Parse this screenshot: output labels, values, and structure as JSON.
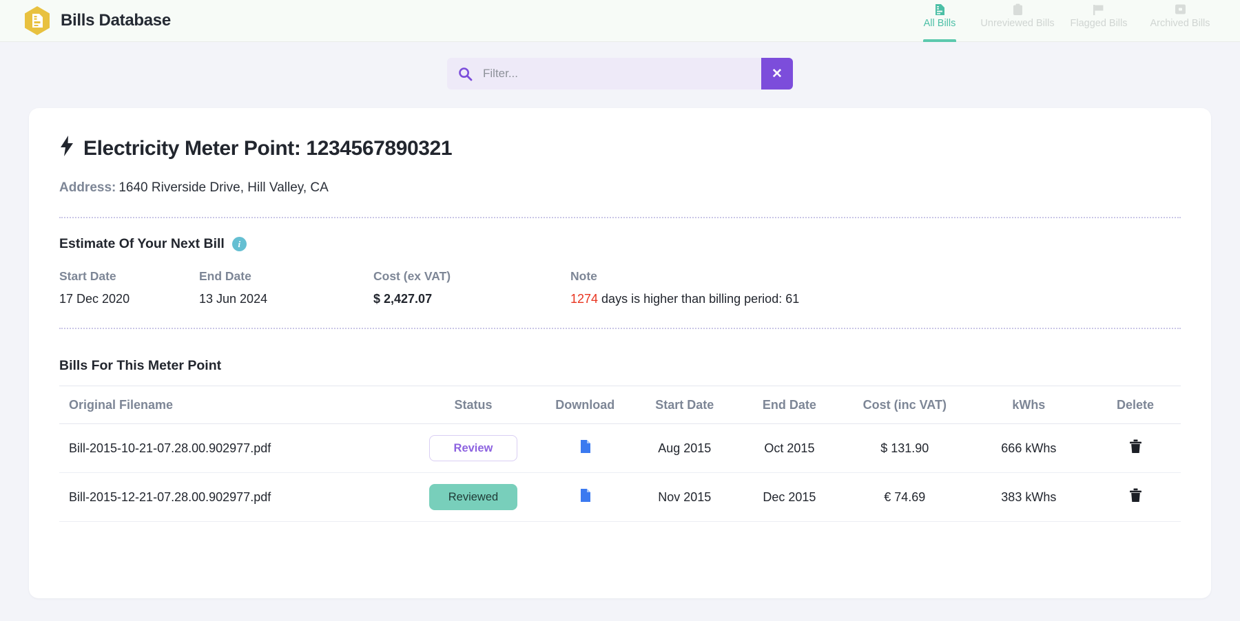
{
  "header": {
    "brand_title": "Bills Database",
    "logo_icon": "document-hexagon-logo",
    "tabs": [
      {
        "label": "All Bills",
        "icon": "document-icon",
        "active": true
      },
      {
        "label": "Unreviewed Bills",
        "icon": "clipboard-icon",
        "active": false
      },
      {
        "label": "Flagged Bills",
        "icon": "flag-icon",
        "active": false
      },
      {
        "label": "Archived Bills",
        "icon": "archive-icon",
        "active": false
      }
    ]
  },
  "search": {
    "value": "",
    "placeholder": "Filter...",
    "search_icon": "search-icon",
    "clear_label": "✕"
  },
  "meter": {
    "icon": "lightning-bolt-icon",
    "title": "Electricity Meter Point: 1234567890321",
    "address_label": "Address:",
    "address_value": "1640 Riverside Drive, Hill Valley, CA"
  },
  "estimate": {
    "heading": "Estimate Of Your Next Bill",
    "info_icon": "info-icon",
    "info_glyph": "i",
    "fields": [
      {
        "label": "Start Date",
        "value": "17 Dec 2020"
      },
      {
        "label": "End Date",
        "value": "13 Jun 2024"
      },
      {
        "label": "Cost (ex VAT)",
        "value": "$ 2,427.07"
      }
    ],
    "note": {
      "label": "Note",
      "highlight": "1274",
      "text": " days is higher than billing period: 61"
    }
  },
  "bills_table": {
    "title": "Bills For This Meter Point",
    "columns": [
      "Original Filename",
      "Status",
      "Download",
      "Start Date",
      "End Date",
      "Cost (inc VAT)",
      "kWhs",
      "Delete"
    ],
    "rows": [
      {
        "filename": "Bill-2015-10-21-07.28.00.902977.pdf",
        "status": "Review",
        "status_type": "review",
        "download_icon": "file-download-icon",
        "start_date": "Aug 2015",
        "end_date": "Oct 2015",
        "cost": "$ 131.90",
        "kwhs": "666 kWhs",
        "delete_icon": "trash-icon"
      },
      {
        "filename": "Bill-2015-12-21-07.28.00.902977.pdf",
        "status": "Reviewed",
        "status_type": "reviewed",
        "download_icon": "file-download-icon",
        "start_date": "Nov 2015",
        "end_date": "Dec 2015",
        "cost": "€ 74.69",
        "kwhs": "383 kWhs",
        "delete_icon": "trash-icon"
      }
    ]
  },
  "colors": {
    "brand_yellow": "#e8c13f",
    "accent_teal": "#5cc9ae",
    "accent_purple": "#7c4ddb",
    "danger_red": "#e8341f",
    "download_blue": "#3b7af0",
    "page_bg": "#f3f4f9",
    "topbar_bg": "#f7fbf7"
  }
}
